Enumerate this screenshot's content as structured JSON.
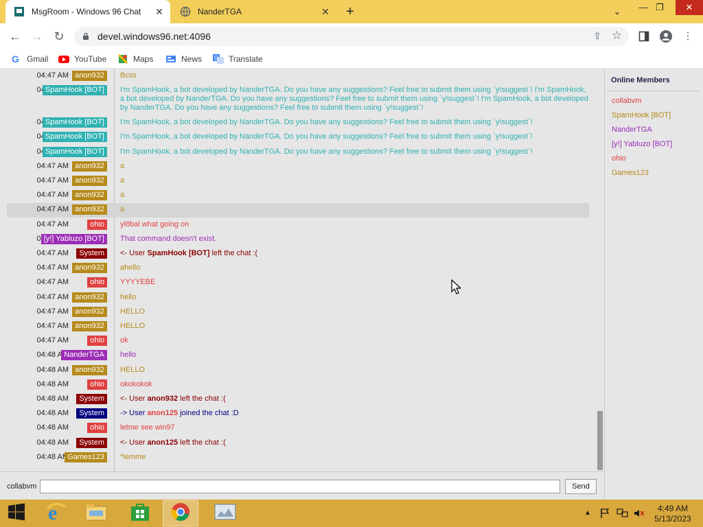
{
  "browser": {
    "tabs": [
      {
        "title": "MsgRoom - Windows 96 Chat",
        "active": true
      },
      {
        "title": "NanderTGA",
        "active": false
      }
    ],
    "url": "devel.windows96.net:4096",
    "bookmarks": [
      {
        "label": "Gmail",
        "icon": "gmail-icon"
      },
      {
        "label": "YouTube",
        "icon": "youtube-icon"
      },
      {
        "label": "Maps",
        "icon": "maps-icon"
      },
      {
        "label": "News",
        "icon": "news-icon"
      },
      {
        "label": "Translate",
        "icon": "translate-icon"
      }
    ]
  },
  "colors": {
    "anon932": "#b58a1b",
    "spamhook": "#2fb1b1",
    "ohio": "#e04040",
    "yabluzo": "#9c2db6",
    "system": "#8b0000",
    "nandertga": "#9c2db6",
    "anon125": "#e04040",
    "games123": "#b58a1b"
  },
  "messages": [
    {
      "time": "04:47 AM",
      "user": "anon932",
      "color": "#b58a1b",
      "text": "Bcss",
      "text_color": "#b58a1b"
    },
    {
      "time": "04:47 AM",
      "user": "SpamHook [BOT]",
      "color": "#2fb1b1",
      "text": "I'm SpamHook, a bot developed by NanderTGA. Do you have any suggestions? Feel free to submit them using `y!suggest`! I'm SpamHook, a bot developed by NanderTGA. Do you have any suggestions? Feel free to submit them using `y!suggest`! I'm SpamHook, a bot developed by NanderTGA. Do you have any suggestions? Feel free to submit them using `y!suggest`!",
      "text_color": "#2fb1b1",
      "multi": true
    },
    {
      "time": "04:47 AM",
      "user": "SpamHook [BOT]",
      "color": "#2fb1b1",
      "text": "I'm SpamHook, a bot developed by NanderTGA. Do you have any suggestions? Feel free to submit them using `y!suggest`!",
      "text_color": "#2fb1b1"
    },
    {
      "time": "04:47 AM",
      "user": "SpamHook [BOT]",
      "color": "#2fb1b1",
      "text": "I'm SpamHook, a bot developed by NanderTGA. Do you have any suggestions? Feel free to submit them using `y!suggest`!",
      "text_color": "#2fb1b1"
    },
    {
      "time": "04:47 AM",
      "user": "SpamHook [BOT]",
      "color": "#2fb1b1",
      "text": "I'm SpamHook, a bot developed by NanderTGA. Do you have any suggestions? Feel free to submit them using `y!suggest`!",
      "text_color": "#2fb1b1"
    },
    {
      "time": "04:47 AM",
      "user": "anon932",
      "color": "#b58a1b",
      "text": "a",
      "text_color": "#b58a1b"
    },
    {
      "time": "04:47 AM",
      "user": "anon932",
      "color": "#b58a1b",
      "text": "a",
      "text_color": "#b58a1b"
    },
    {
      "time": "04:47 AM",
      "user": "anon932",
      "color": "#b58a1b",
      "text": "a",
      "text_color": "#b58a1b"
    },
    {
      "time": "04:47 AM",
      "user": "anon932",
      "color": "#b58a1b",
      "text": "a",
      "text_color": "#b58a1b",
      "highlight": true
    },
    {
      "time": "04:47 AM",
      "user": "ohio",
      "color": "#e04040",
      "text": "yl8bal what going on",
      "text_color": "#e04040"
    },
    {
      "time": "04:47 AM",
      "user": "[y!] Yabluzo [BOT]",
      "color": "#9c2db6",
      "text": "That command doesn't exist.",
      "text_color": "#9c2db6"
    },
    {
      "time": "04:47 AM",
      "user": "System",
      "color": "#8b0000",
      "system": true,
      "prefix": "<- User ",
      "subject": "SpamHook [BOT]",
      "suffix": " left the chat :(",
      "text_color": "#8b0000",
      "subject_color": "#8b0000"
    },
    {
      "time": "04:47 AM",
      "user": "anon932",
      "color": "#b58a1b",
      "text": "ahello",
      "text_color": "#b58a1b"
    },
    {
      "time": "04:47 AM",
      "user": "ohio",
      "color": "#e04040",
      "text": "YYYYEBE",
      "text_color": "#e04040"
    },
    {
      "time": "04:47 AM",
      "user": "anon932",
      "color": "#b58a1b",
      "text": "hello",
      "text_color": "#b58a1b"
    },
    {
      "time": "04:47 AM",
      "user": "anon932",
      "color": "#b58a1b",
      "text": "HELLO",
      "text_color": "#b58a1b"
    },
    {
      "time": "04:47 AM",
      "user": "anon932",
      "color": "#b58a1b",
      "text": "HELLO",
      "text_color": "#b58a1b"
    },
    {
      "time": "04:47 AM",
      "user": "ohio",
      "color": "#e04040",
      "text": "ok",
      "text_color": "#e04040"
    },
    {
      "time": "04:48 AM",
      "user": "NanderTGA",
      "color": "#9c2db6",
      "text": "hello",
      "text_color": "#9c2db6"
    },
    {
      "time": "04:48 AM",
      "user": "anon932",
      "color": "#b58a1b",
      "text": "HELLO",
      "text_color": "#b58a1b"
    },
    {
      "time": "04:48 AM",
      "user": "ohio",
      "color": "#e04040",
      "text": "okokokok",
      "text_color": "#e04040"
    },
    {
      "time": "04:48 AM",
      "user": "System",
      "color": "#8b0000",
      "system": true,
      "prefix": "<- User ",
      "subject": "anon932",
      "suffix": " left the chat :(",
      "text_color": "#8b0000",
      "subject_color": "#8b0000"
    },
    {
      "time": "04:48 AM",
      "user": "System",
      "color": "#000080",
      "system": true,
      "prefix": "-> User ",
      "subject": "anon125",
      "suffix": " joined the chat :D",
      "text_color": "#000080",
      "subject_color": "#e04040"
    },
    {
      "time": "04:48 AM",
      "user": "ohio",
      "color": "#e04040",
      "text": "letme see win97",
      "text_color": "#e04040"
    },
    {
      "time": "04:48 AM",
      "user": "System",
      "color": "#8b0000",
      "system": true,
      "prefix": "<- User ",
      "subject": "anon125",
      "suffix": " left the chat :(",
      "text_color": "#8b0000",
      "subject_color": "#8b0000"
    },
    {
      "time": "04:48 AM",
      "user": "Games123",
      "color": "#b58a1b",
      "text": "*lemme",
      "text_color": "#b58a1b"
    }
  ],
  "members": {
    "header": "Online Members",
    "list": [
      {
        "name": "collabvm",
        "color": "#e04040"
      },
      {
        "name": "SpamHook [BOT]",
        "color": "#b58a1b"
      },
      {
        "name": "NanderTGA",
        "color": "#9c2db6"
      },
      {
        "name": "[y!] Yabluzo [BOT]",
        "color": "#9c2db6"
      },
      {
        "name": "ohio",
        "color": "#e04040"
      },
      {
        "name": "Games123",
        "color": "#b58a1b"
      }
    ]
  },
  "input": {
    "nick": "collabvm",
    "value": "",
    "send_label": "Send"
  },
  "taskbar": {
    "items": [
      "start-icon",
      "internet-explorer-icon",
      "file-explorer-icon",
      "store-icon",
      "chrome-icon",
      "app-icon"
    ],
    "clock_time": "4:49 AM",
    "clock_date": "5/13/2023"
  }
}
